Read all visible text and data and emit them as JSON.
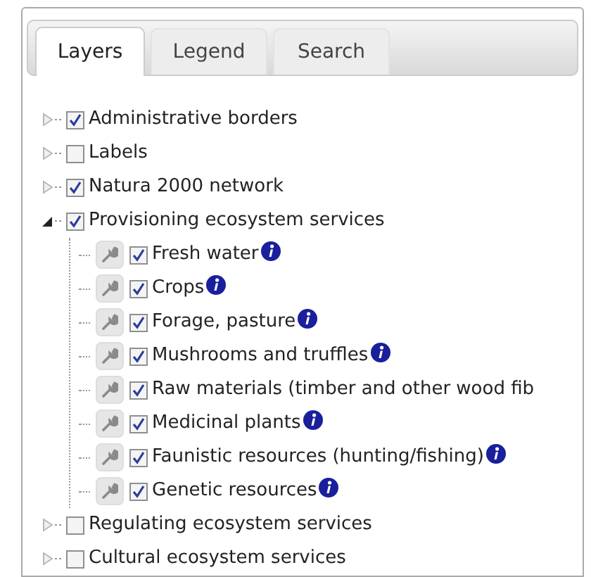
{
  "tabs": [
    {
      "label": "Layers",
      "selected": true
    },
    {
      "label": "Legend",
      "selected": false
    },
    {
      "label": "Search",
      "selected": false
    }
  ],
  "layers": [
    {
      "label": "Administrative borders",
      "checked": true,
      "expanded": false
    },
    {
      "label": "Labels",
      "checked": false,
      "expanded": false
    },
    {
      "label": "Natura 2000 network",
      "checked": true,
      "expanded": false
    },
    {
      "label": "Provisioning ecosystem services",
      "checked": true,
      "expanded": true,
      "children": [
        {
          "label": "Fresh water",
          "checked": true,
          "info": true
        },
        {
          "label": "Crops",
          "checked": true,
          "info": true
        },
        {
          "label": "Forage, pasture",
          "checked": true,
          "info": true
        },
        {
          "label": "Mushrooms and truffles",
          "checked": true,
          "info": true
        },
        {
          "label": "Raw materials (timber and other wood fib",
          "checked": true,
          "info": false
        },
        {
          "label": "Medicinal plants",
          "checked": true,
          "info": true
        },
        {
          "label": "Faunistic resources (hunting/fishing)",
          "checked": true,
          "info": true
        },
        {
          "label": "Genetic resources",
          "checked": true,
          "info": true
        }
      ]
    },
    {
      "label": "Regulating ecosystem services",
      "checked": false,
      "expanded": false
    },
    {
      "label": "Cultural ecosystem services",
      "checked": false,
      "expanded": false
    }
  ]
}
